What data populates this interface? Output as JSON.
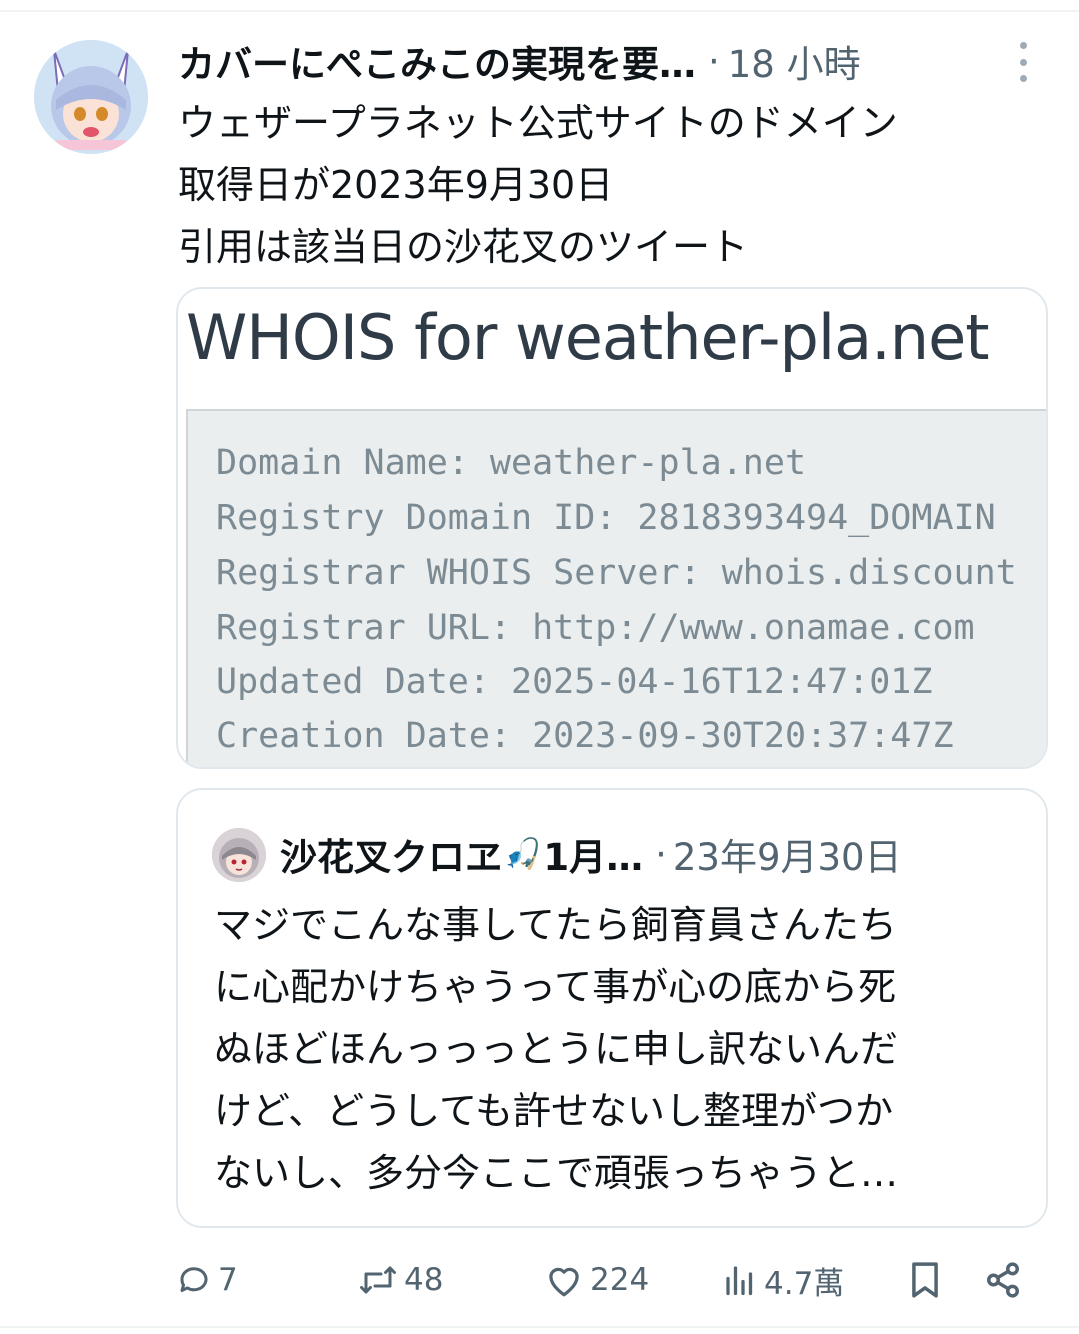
{
  "tweet": {
    "display_name": "カバーにぺこみこの実現を要…",
    "separator": "·",
    "time": "18 小時",
    "lines": [
      "ウェザープラネット公式サイトのドメイン",
      "取得日が2023年9月30日",
      "引用は該当日の沙花叉のツイート"
    ]
  },
  "media": {
    "title": "WHOIS for weather-pla.net",
    "lines": [
      "Domain Name: weather-pla.net",
      "Registry Domain ID: 2818393494_DOMAIN",
      "Registrar WHOIS Server: whois.discount",
      "Registrar URL: http://www.onamae.com",
      "Updated Date: 2025-04-16T12:47:01Z",
      "Creation Date: 2023-09-30T20:37:47Z"
    ]
  },
  "quote": {
    "display_name": "沙花叉クロヱ",
    "emoji": "🎣",
    "name_suffix": "1月…",
    "separator": "·",
    "time": "23年9月30日",
    "lines": [
      "マジでこんな事してたら飼育員さんたち",
      "に心配かけちゃうって事が心の底から死",
      "ぬほどほんっっっとうに申し訳ないんだ",
      "けど、どうしても許せないし整理がつか",
      "ないし、多分今ここで頑張っちゃうと…"
    ]
  },
  "actions": {
    "replies": "7",
    "reposts": "48",
    "likes": "224",
    "views": "4.7萬",
    "icons": [
      "reply-icon",
      "repost-icon",
      "like-icon",
      "views-icon",
      "bookmark-icon",
      "share-icon"
    ]
  },
  "colors": {
    "text": "#0f1419",
    "secondary": "#536471",
    "border": "#e1e8ed"
  }
}
